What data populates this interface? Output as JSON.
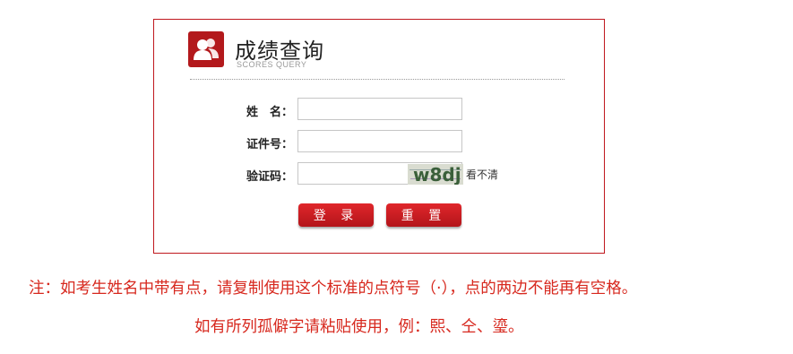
{
  "header": {
    "title": "成绩查询",
    "subtitle": "SCORES QUERY"
  },
  "form": {
    "name_label": "姓　名：",
    "name_value": "",
    "id_label": "证件号：",
    "id_value": "",
    "captcha_label": "验证码：",
    "captcha_value": "",
    "captcha_text": "w8dj",
    "refresh_text": "看不清"
  },
  "buttons": {
    "login": "登 录",
    "reset": "重 置"
  },
  "notes": {
    "line1": "注：如考生姓名中带有点，请复制使用这个标准的点符号（·），点的两边不能再有空格。",
    "line2": "如有所列孤僻字请粘贴使用，例：𤋮、仝、瑬。"
  },
  "colors": {
    "accent": "#c0181e",
    "note": "#d7281e"
  }
}
